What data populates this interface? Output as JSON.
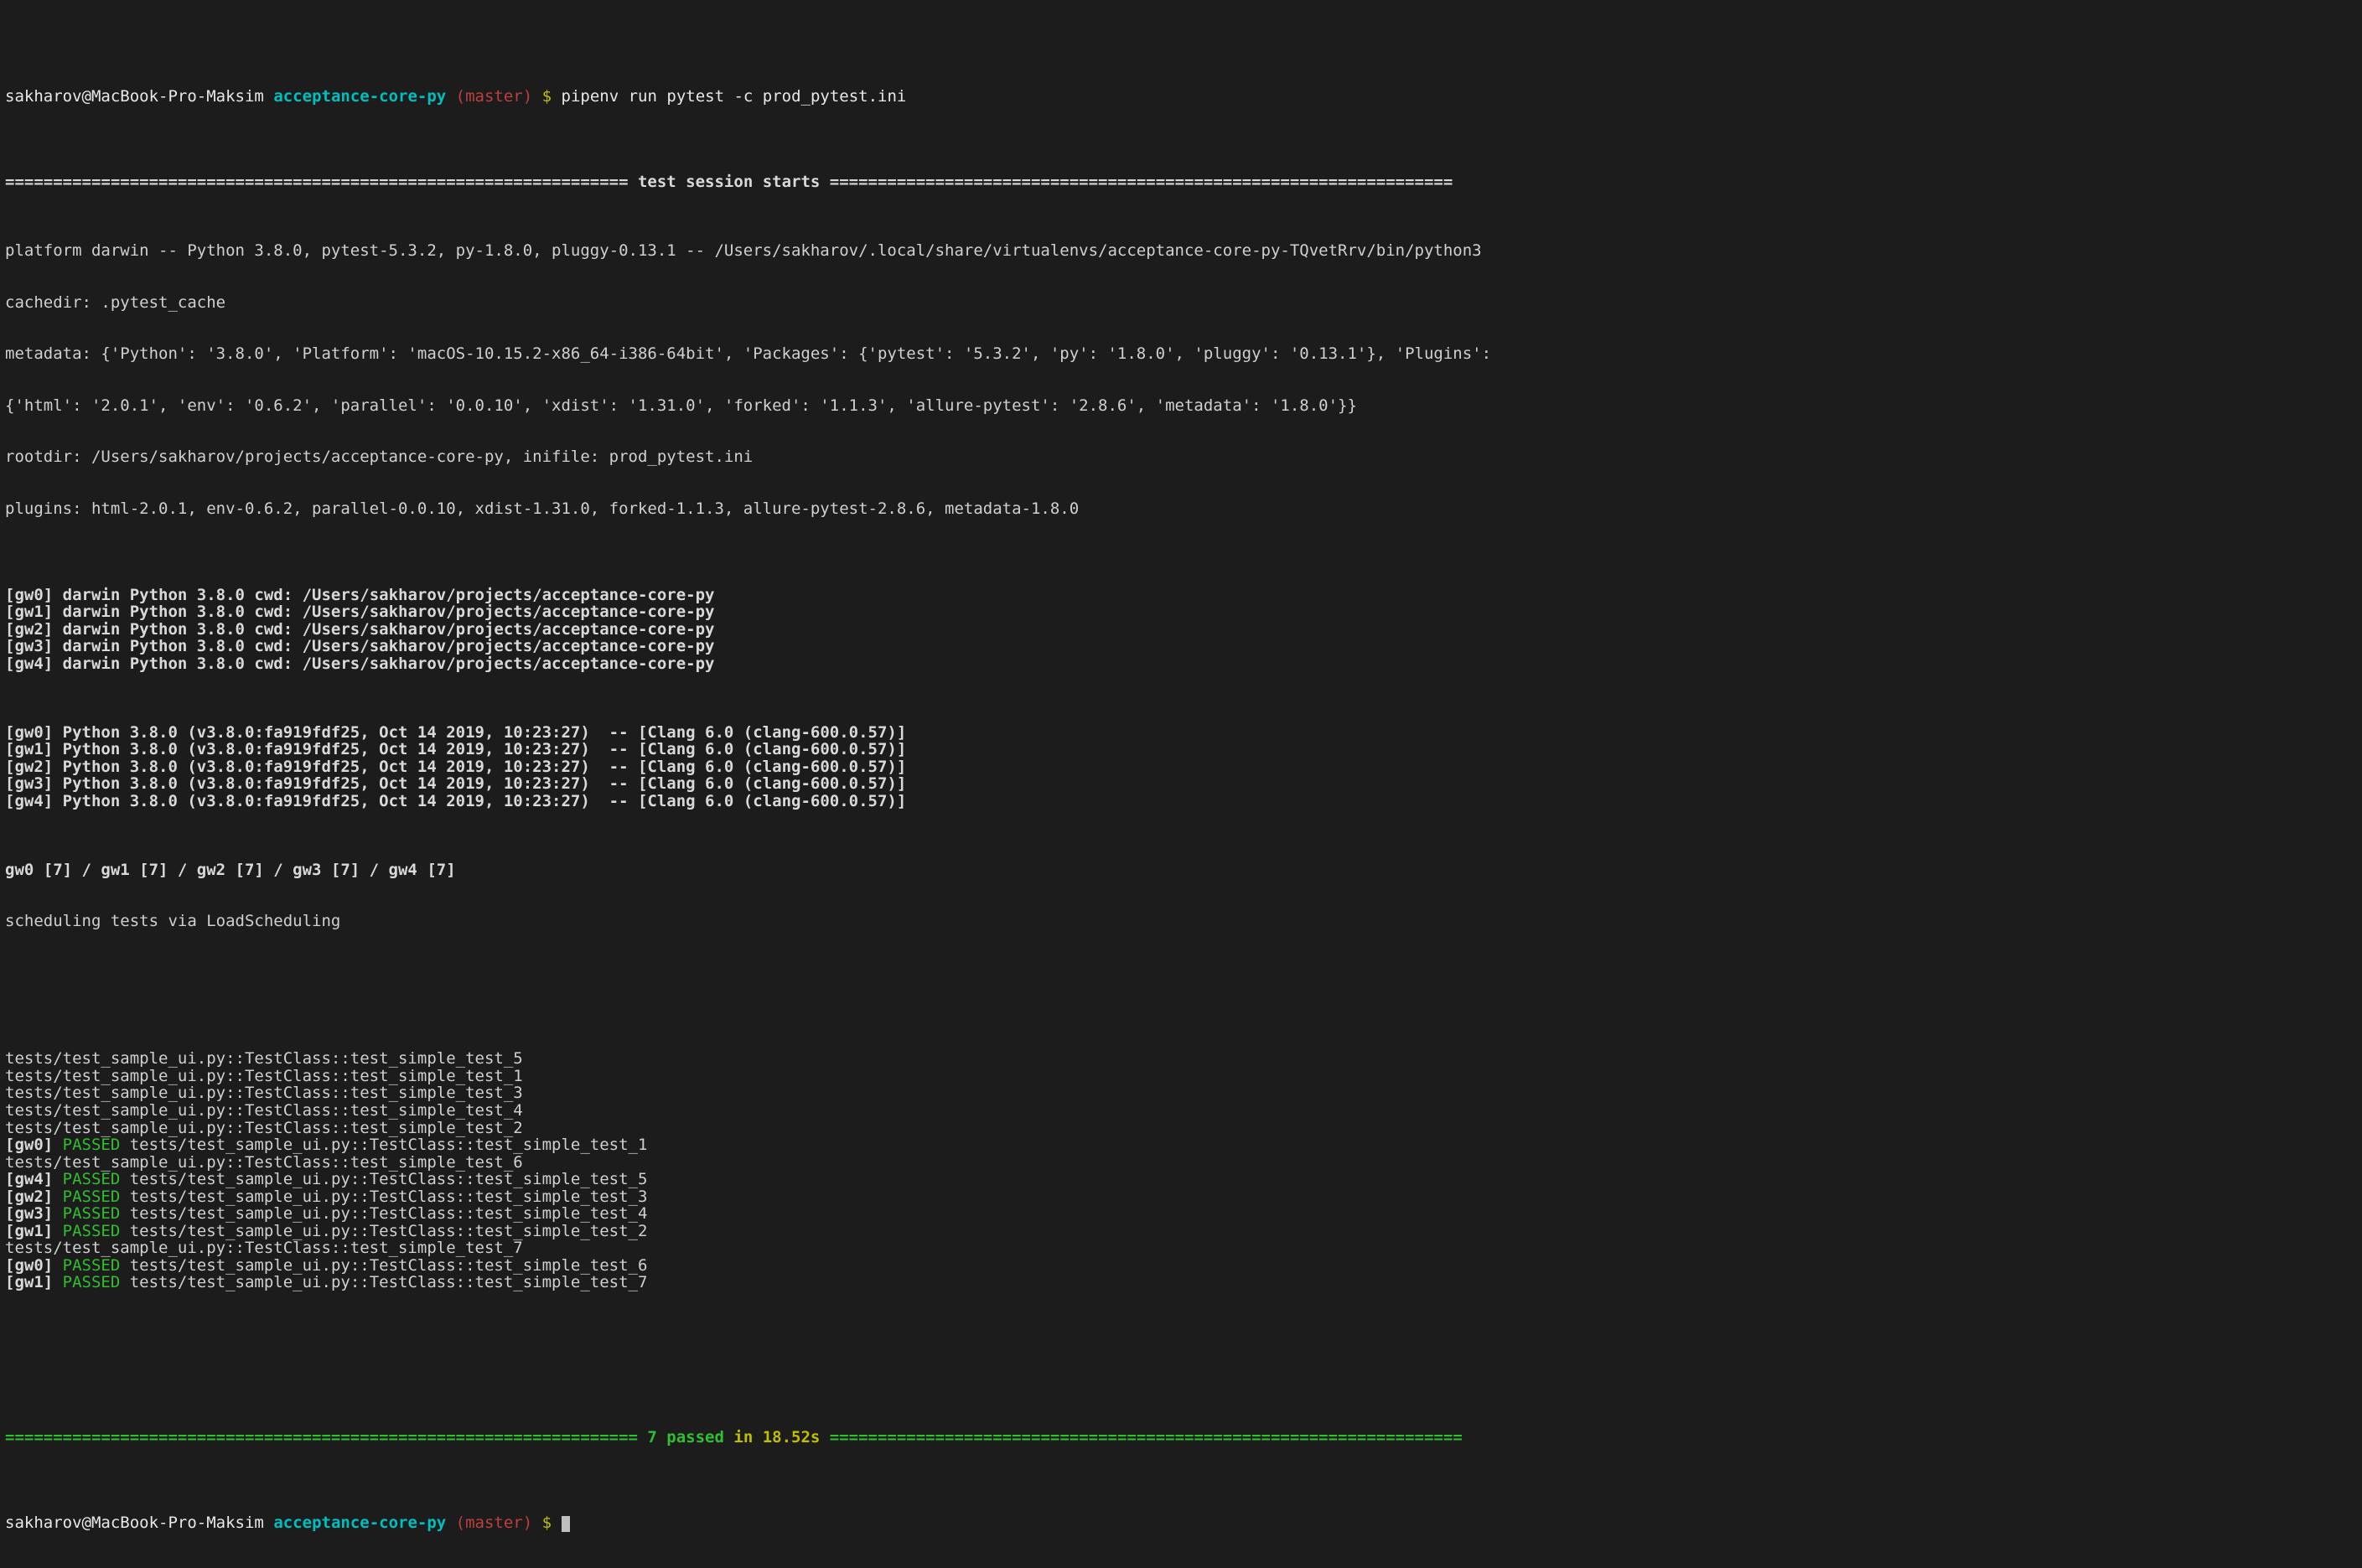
{
  "prompt1": {
    "user_host": "sakharov@MacBook-Pro-Maksim",
    "cwd": "acceptance-core-py",
    "branch": "(master)",
    "dollar": "$",
    "command": "pipenv run pytest -c prod_pytest.ini"
  },
  "session_header": {
    "rule_left": "=================================================================",
    "title": " test session starts ",
    "rule_right": "================================================================="
  },
  "platform_line": "platform darwin -- Python 3.8.0, pytest-5.3.2, py-1.8.0, pluggy-0.13.1 -- /Users/sakharov/.local/share/virtualenvs/acceptance-core-py-TQvetRrv/bin/python3",
  "cachedir_line": "cachedir: .pytest_cache",
  "metadata_line1": "metadata: {'Python': '3.8.0', 'Platform': 'macOS-10.15.2-x86_64-i386-64bit', 'Packages': {'pytest': '5.3.2', 'py': '1.8.0', 'pluggy': '0.13.1'}, 'Plugins':",
  "metadata_line2": "{'html': '2.0.1', 'env': '0.6.2', 'parallel': '0.0.10', 'xdist': '1.31.0', 'forked': '1.1.3', 'allure-pytest': '2.8.6', 'metadata': '1.8.0'}}",
  "rootdir_line": "rootdir: /Users/sakharov/projects/acceptance-core-py, inifile: prod_pytest.ini",
  "plugins_line": "plugins: html-2.0.1, env-0.6.2, parallel-0.0.10, xdist-1.31.0, forked-1.1.3, allure-pytest-2.8.6, metadata-1.8.0",
  "workers_cwd": [
    {
      "id": "[gw0]",
      "rest": " darwin Python 3.8.0 cwd: /Users/sakharov/projects/acceptance-core-py"
    },
    {
      "id": "[gw1]",
      "rest": " darwin Python 3.8.0 cwd: /Users/sakharov/projects/acceptance-core-py"
    },
    {
      "id": "[gw2]",
      "rest": " darwin Python 3.8.0 cwd: /Users/sakharov/projects/acceptance-core-py"
    },
    {
      "id": "[gw3]",
      "rest": " darwin Python 3.8.0 cwd: /Users/sakharov/projects/acceptance-core-py"
    },
    {
      "id": "[gw4]",
      "rest": " darwin Python 3.8.0 cwd: /Users/sakharov/projects/acceptance-core-py"
    }
  ],
  "workers_ver": [
    {
      "id": "[gw0]",
      "rest": " Python 3.8.0 (v3.8.0:fa919fdf25, Oct 14 2019, 10:23:27)  -- [Clang 6.0 (clang-600.0.57)]"
    },
    {
      "id": "[gw1]",
      "rest": " Python 3.8.0 (v3.8.0:fa919fdf25, Oct 14 2019, 10:23:27)  -- [Clang 6.0 (clang-600.0.57)]"
    },
    {
      "id": "[gw2]",
      "rest": " Python 3.8.0 (v3.8.0:fa919fdf25, Oct 14 2019, 10:23:27)  -- [Clang 6.0 (clang-600.0.57)]"
    },
    {
      "id": "[gw3]",
      "rest": " Python 3.8.0 (v3.8.0:fa919fdf25, Oct 14 2019, 10:23:27)  -- [Clang 6.0 (clang-600.0.57)]"
    },
    {
      "id": "[gw4]",
      "rest": " Python 3.8.0 (v3.8.0:fa919fdf25, Oct 14 2019, 10:23:27)  -- [Clang 6.0 (clang-600.0.57)]"
    }
  ],
  "gw_counts_line": "gw0 [7] / gw1 [7] / gw2 [7] / gw3 [7] / gw4 [7]",
  "scheduling_line": "scheduling tests via LoadScheduling",
  "blank": " ",
  "results": [
    {
      "type": "plain",
      "text": "tests/test_sample_ui.py::TestClass::test_simple_test_5 "
    },
    {
      "type": "plain",
      "text": "tests/test_sample_ui.py::TestClass::test_simple_test_1 "
    },
    {
      "type": "plain",
      "text": "tests/test_sample_ui.py::TestClass::test_simple_test_3 "
    },
    {
      "type": "plain",
      "text": "tests/test_sample_ui.py::TestClass::test_simple_test_4 "
    },
    {
      "type": "plain",
      "text": "tests/test_sample_ui.py::TestClass::test_simple_test_2 "
    },
    {
      "type": "pass",
      "gw": "[gw0] ",
      "status": "PASSED",
      "path": " tests/test_sample_ui.py::TestClass::test_simple_test_1 "
    },
    {
      "type": "plain",
      "text": "tests/test_sample_ui.py::TestClass::test_simple_test_6 "
    },
    {
      "type": "pass",
      "gw": "[gw4] ",
      "status": "PASSED",
      "path": " tests/test_sample_ui.py::TestClass::test_simple_test_5 "
    },
    {
      "type": "pass",
      "gw": "[gw2] ",
      "status": "PASSED",
      "path": " tests/test_sample_ui.py::TestClass::test_simple_test_3 "
    },
    {
      "type": "pass",
      "gw": "[gw3] ",
      "status": "PASSED",
      "path": " tests/test_sample_ui.py::TestClass::test_simple_test_4 "
    },
    {
      "type": "pass",
      "gw": "[gw1] ",
      "status": "PASSED",
      "path": " tests/test_sample_ui.py::TestClass::test_simple_test_2 "
    },
    {
      "type": "plain",
      "text": "tests/test_sample_ui.py::TestClass::test_simple_test_7 "
    },
    {
      "type": "pass",
      "gw": "[gw0] ",
      "status": "PASSED",
      "path": " tests/test_sample_ui.py::TestClass::test_simple_test_6 "
    },
    {
      "type": "pass",
      "gw": "[gw1] ",
      "status": "PASSED",
      "path": " tests/test_sample_ui.py::TestClass::test_simple_test_7 "
    }
  ],
  "summary": {
    "rule_left": "==================================================================",
    "passed": " 7 passed",
    "time": " in 18.52s ",
    "rule_right": "=================================================================="
  },
  "prompt2": {
    "user_host": "sakharov@MacBook-Pro-Maksim",
    "cwd": "acceptance-core-py",
    "branch": "(master)",
    "dollar": "$"
  }
}
